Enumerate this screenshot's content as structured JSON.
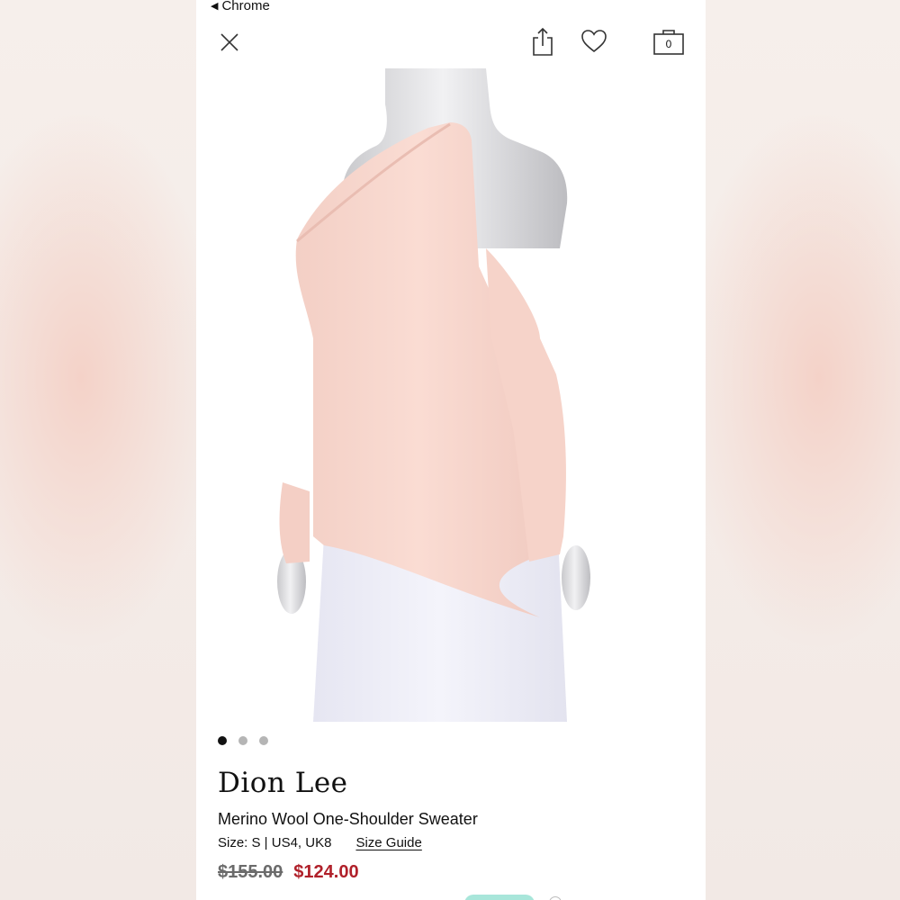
{
  "status_bar": {
    "back_label": "Chrome"
  },
  "header": {
    "close_icon": "close-icon",
    "share_icon": "share-icon",
    "favorite_icon": "heart-icon",
    "bag_icon": "shopping-bag-icon",
    "bag_count": "0"
  },
  "gallery": {
    "image_subject": "pink one-shoulder sweater on mannequin",
    "total_images": 3,
    "active_index": 0
  },
  "product": {
    "brand": "Dion Lee",
    "title": "Merino Wool One-Shoulder Sweater",
    "size_text": "Size: S | US4, UK8",
    "size_guide_label": "Size Guide",
    "original_price": "$155.00",
    "sale_price": "$124.00"
  },
  "colors": {
    "sale_price": "#b0202a",
    "sweater": "#f9d9d0",
    "skirt": "#eeeef8"
  }
}
